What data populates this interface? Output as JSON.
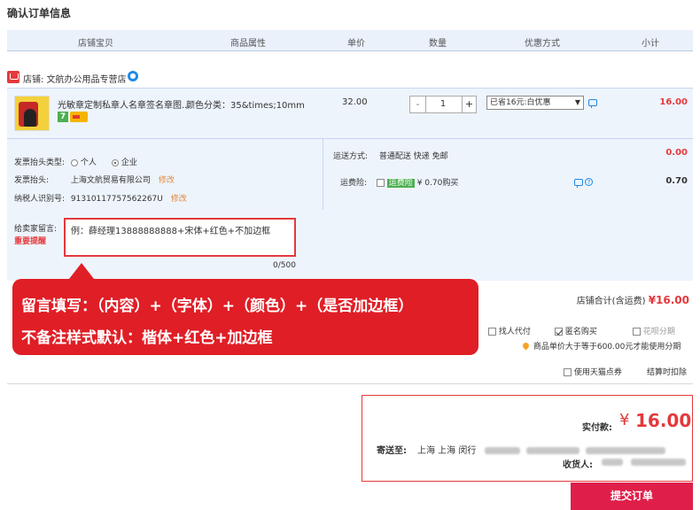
{
  "page": {
    "title": "确认订单信息"
  },
  "columns": [
    "店铺宝贝",
    "商品属性",
    "单价",
    "数量",
    "优惠方式",
    "小计"
  ],
  "shop": {
    "label": "店铺: 文航办公用品专营店"
  },
  "item": {
    "name": "光敏章定制私章人名章签名章图...",
    "attr": "颜色分类：35&times;10mm",
    "price": "32.00",
    "qty": "1",
    "minus": "-",
    "plus": "+",
    "discount": "已省16元:白优惠",
    "subtotal": "16.00",
    "badge_seven": "7"
  },
  "invoice": {
    "type_label": "发票抬头类型:",
    "type_personal": "个人",
    "type_company": "企业",
    "selected": "企业",
    "title_label": "发票抬头:",
    "title_value": "上海文航贸易有限公司",
    "title_edit": "修改",
    "taxid_label": "纳税人识别号:",
    "taxid_value": "91310117757562267U",
    "taxid_edit": "修改"
  },
  "shipping": {
    "label": "运送方式:",
    "value": "普通配送 快递 免邮",
    "price": "0.00",
    "insurance_label": "运费险:",
    "insurance_tag": "运费险",
    "insurance_text": "¥ 0.70购买",
    "insurance_price": "0.70"
  },
  "message": {
    "label": "给卖家留言:",
    "warning": "重要提醒",
    "value": "例：薛经理13888888888+宋体+红色+不加边框",
    "counter": "0/500"
  },
  "callout": {
    "line1": "留言填写：（内容）+（字体）+（颜色）+（是否加边框）",
    "line2": "不备注样式默认：楷体+红色+加边框"
  },
  "shop_total": {
    "label": "店铺合计(含运费)",
    "value": "¥16.00"
  },
  "extras": {
    "proxy_pay": "找人代付",
    "anonymous": "匿名购买",
    "anonymous_checked": true,
    "installment": "花呗分期",
    "installment_note": "商品单价大于等于600.00元才能使用分期",
    "tmall_coupon": "使用天猫点券",
    "settle_deduct": "结算时扣除"
  },
  "summary": {
    "pay_label": "实付款:",
    "currency": "¥",
    "pay_amount": "16.00",
    "ship_label": "寄送至:",
    "ship_addr": "上海 上海 闵行",
    "recv_label": "收货人:"
  },
  "submit": {
    "label": "提交订单"
  },
  "colors": {
    "accent": "#e4393c",
    "header_bg": "#eaf1fb",
    "row_bg": "#eef4fc",
    "callout_bg": "#e01e26",
    "submit_bg": "#e01e4a"
  },
  "icons": [
    "shop-icon",
    "shop-badge-icon",
    "chat-icon",
    "help-icon",
    "location-pin-icon"
  ]
}
